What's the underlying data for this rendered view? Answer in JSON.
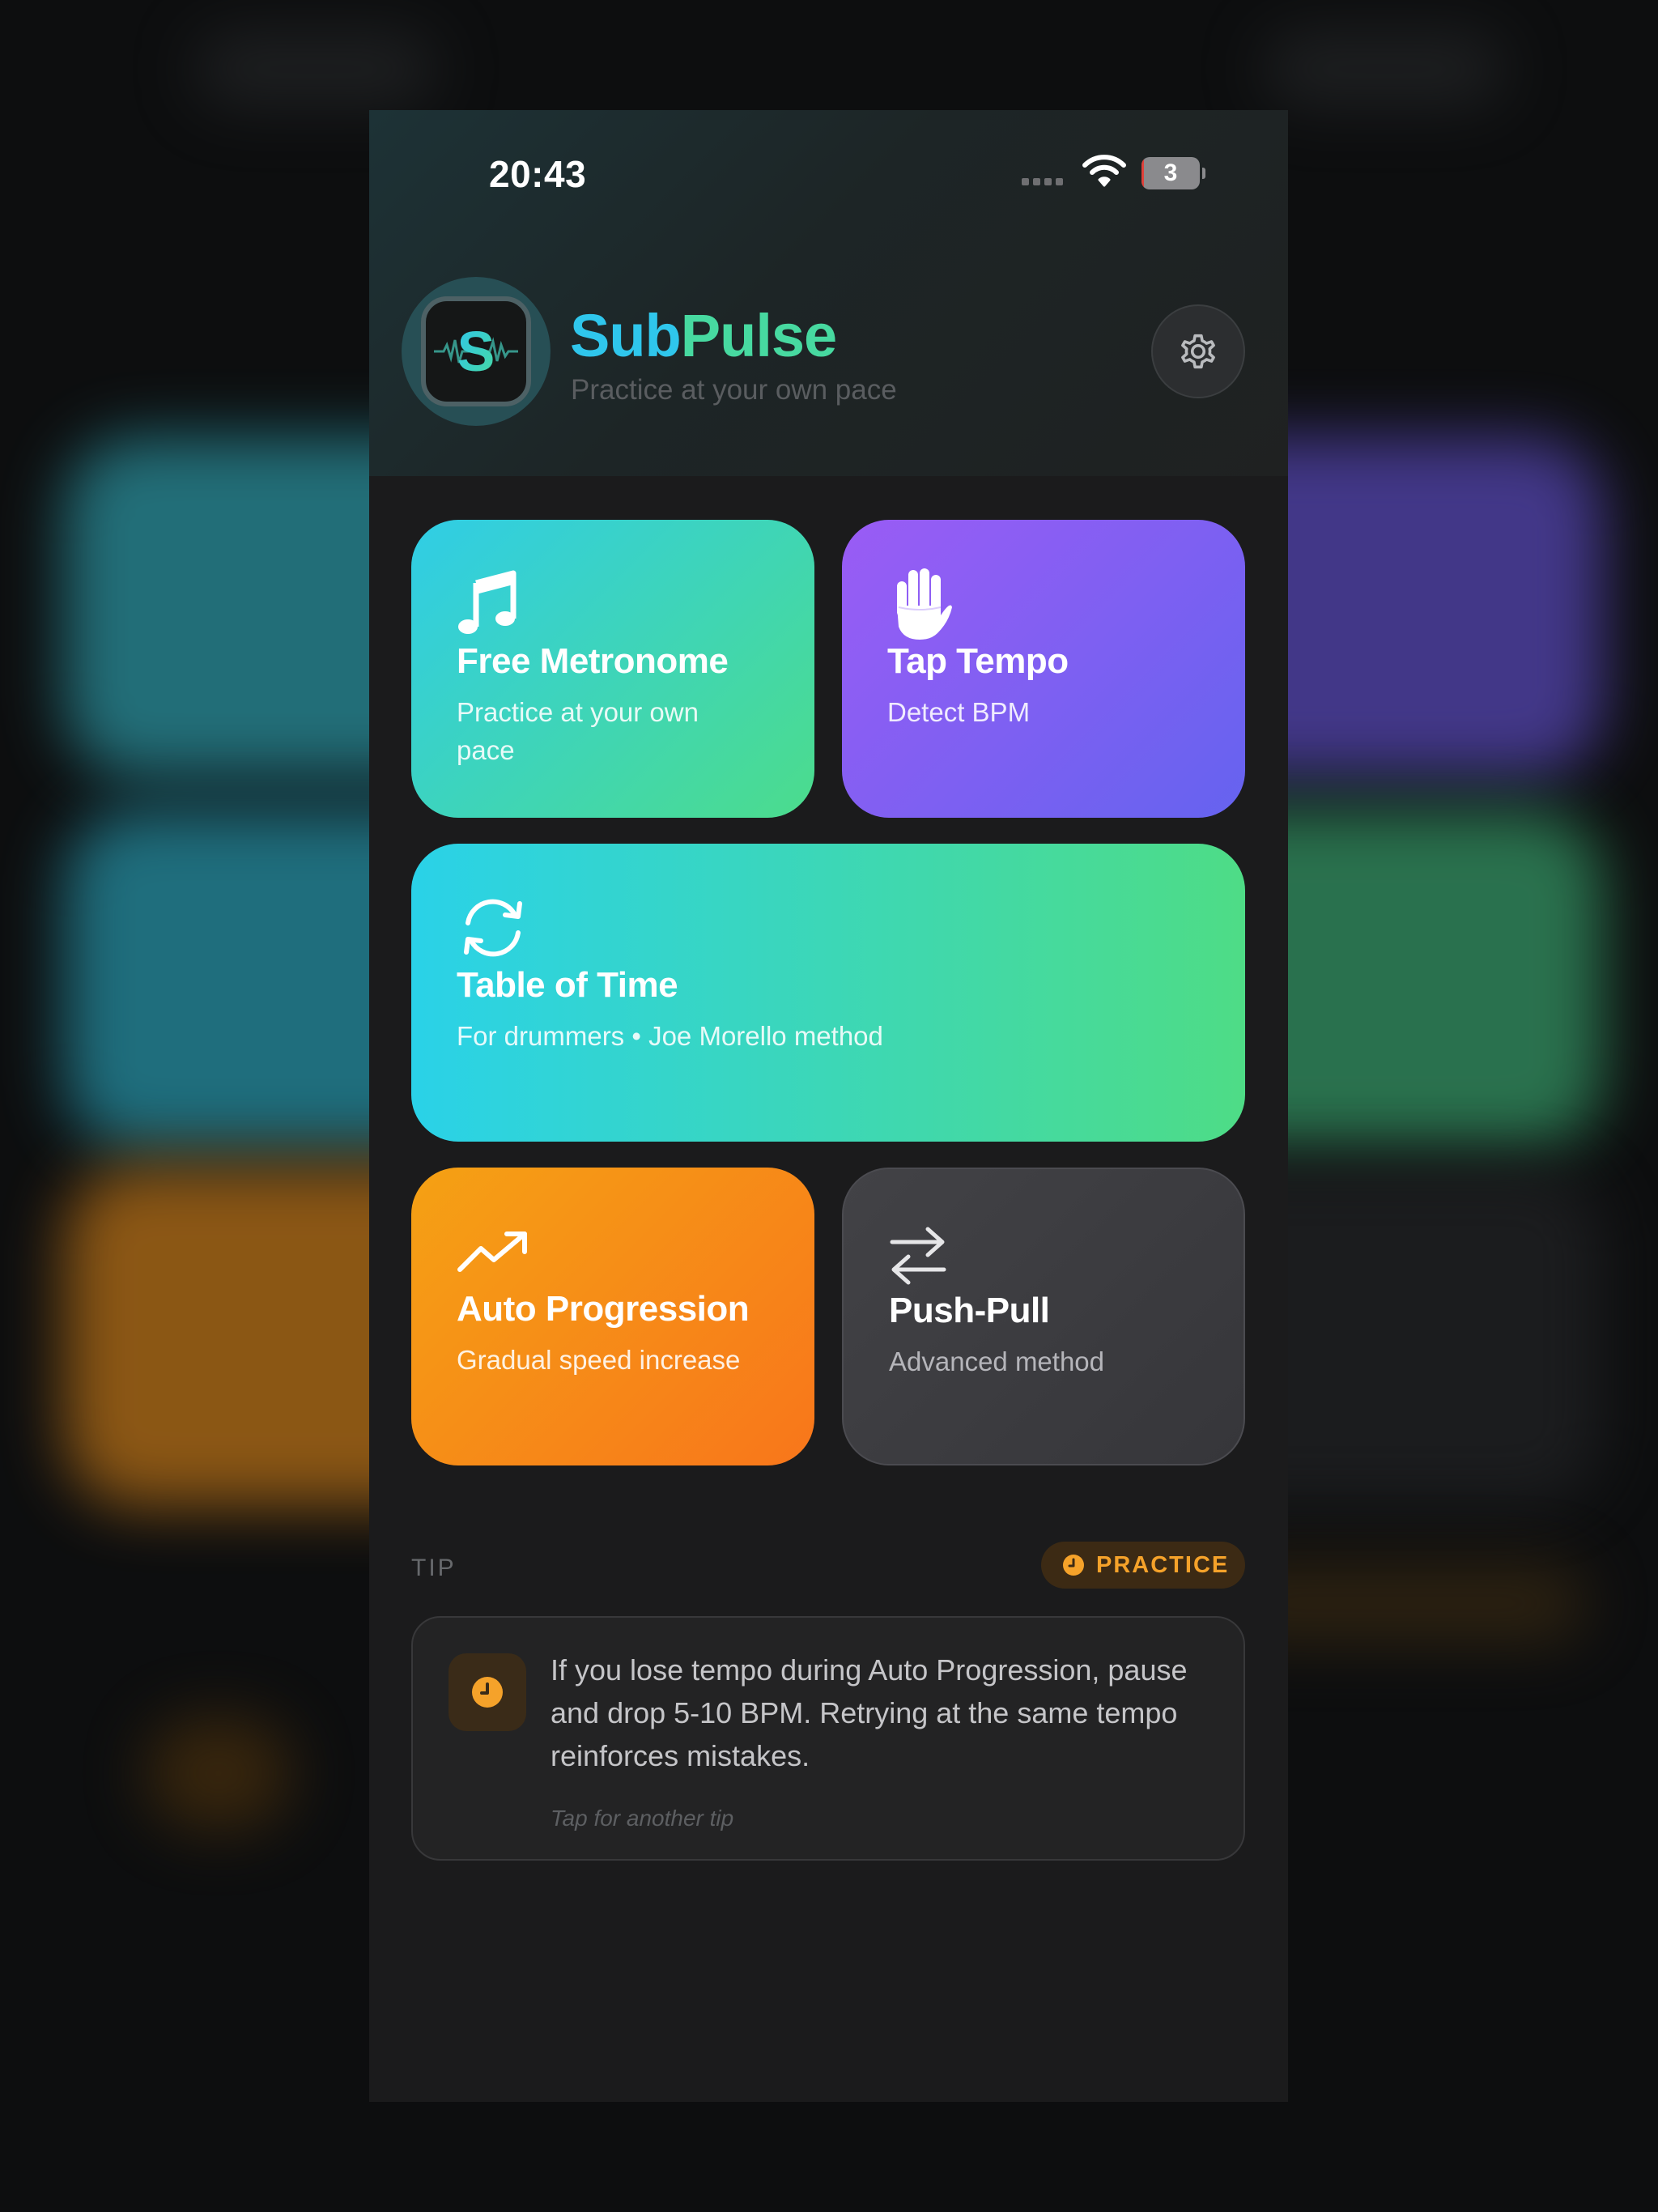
{
  "status_bar": {
    "time": "20:43",
    "battery_level": "3",
    "battery_fill_percent": 3
  },
  "header": {
    "app_name_part1": "Sub",
    "app_name_part2": "Pulse",
    "subtitle": "Practice at your own pace",
    "logo_letter": "S"
  },
  "cards": {
    "metronome": {
      "title": "Free Metronome",
      "subtitle_line1": "Practice at your own",
      "subtitle_line2": "pace",
      "icon": "music-note-icon"
    },
    "tap_tempo": {
      "title": "Tap Tempo",
      "subtitle": "Detect BPM",
      "icon": "hand-icon"
    },
    "table_of_time": {
      "title": "Table of Time",
      "subtitle": "For drummers • Joe Morello method",
      "icon": "refresh-icon"
    },
    "auto_progression": {
      "title": "Auto Progression",
      "subtitle": "Gradual speed increase",
      "icon": "trending-up-icon"
    },
    "push_pull": {
      "title": "Push-Pull",
      "subtitle": "Advanced method",
      "icon": "arrows-swap-icon"
    }
  },
  "tip": {
    "label": "TIP",
    "badge": "PRACTICE",
    "text": "If you lose tempo during Auto Progression, pause and drop 5-10 BPM. Retrying at the same tempo reinforces mistakes.",
    "hint": "Tap for another tip"
  },
  "colors": {
    "accent_cyan": "#2fc6ec",
    "accent_green": "#47d9a0",
    "metronome_gradient": [
      "#30cde6",
      "#4cdc8c"
    ],
    "tap_gradient": [
      "#9a5cf5",
      "#6563ef"
    ],
    "auto_gradient": [
      "#f5a114",
      "#f8761b"
    ],
    "push_pull_bg": "#3d3d41",
    "tip_accent": "#f5a22a",
    "background": "#1b1b1c"
  }
}
